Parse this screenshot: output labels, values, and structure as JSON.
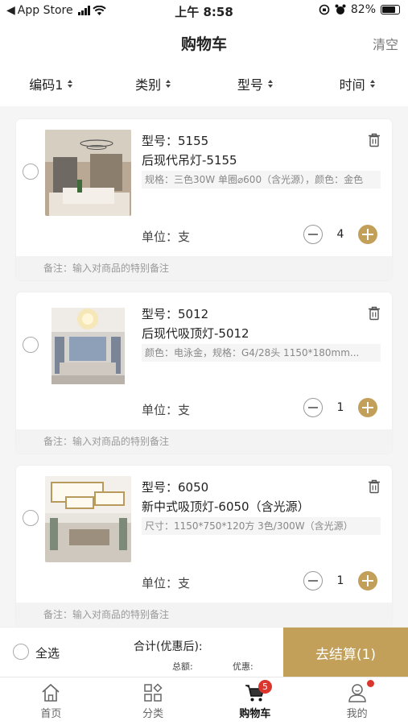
{
  "status_bar": {
    "back_app": "App Store",
    "time": "上午 8:58",
    "battery": "82%"
  },
  "nav": {
    "title": "购物车",
    "clear": "清空"
  },
  "filters": [
    {
      "label": "编码1"
    },
    {
      "label": "类别"
    },
    {
      "label": "型号"
    },
    {
      "label": "时间"
    }
  ],
  "items": [
    {
      "model": "型号：5155",
      "name": "后现代吊灯-5155",
      "spec": "规格：三色30W 单圈⌀600（含光源），颜色：金色",
      "unit": "单位：支",
      "quantity": "4",
      "note": "备注：输入对商品的特别备注"
    },
    {
      "model": "型号：5012",
      "name": "后现代吸顶灯-5012",
      "spec": "颜色：电泳金，规格：G4/28头 1150*180mm...",
      "unit": "单位：支",
      "quantity": "1",
      "note": "备注：输入对商品的特别备注"
    },
    {
      "model": "型号：6050",
      "name": "新中式吸顶灯-6050（含光源）",
      "spec": "尺寸：1150*750*120方 3色/300W（含光源）",
      "unit": "单位：支",
      "quantity": "1",
      "note": "备注：输入对商品的特别备注"
    }
  ],
  "checkout": {
    "select_all": "全选",
    "total_label": "合计(优惠后):",
    "sum_label": "总额:",
    "discount_label": "优惠:",
    "button": "去结算(1)"
  },
  "tabs": [
    {
      "label": "首页",
      "icon": "home-icon"
    },
    {
      "label": "分类",
      "icon": "category-icon"
    },
    {
      "label": "购物车",
      "icon": "cart-icon",
      "badge": "5"
    },
    {
      "label": "我的",
      "icon": "profile-icon"
    }
  ],
  "colors": {
    "accent": "#c2a05a",
    "badge": "#d9362e"
  }
}
